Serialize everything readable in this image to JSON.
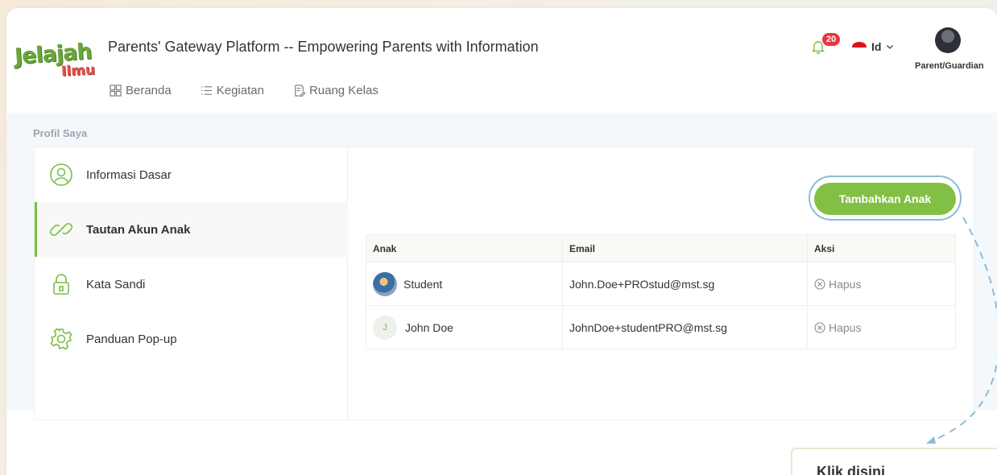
{
  "header": {
    "logo_line1": "Jelajah",
    "logo_line2": "Ilmu",
    "title": "Parents' Gateway Platform -- Empowering Parents with Information",
    "nav": [
      {
        "label": "Beranda",
        "icon": "grid-icon"
      },
      {
        "label": "Kegiatan",
        "icon": "list-icon"
      },
      {
        "label": "Ruang Kelas",
        "icon": "document-edit-icon"
      }
    ],
    "notification_count": "20",
    "language": "Id",
    "role": "Parent/Guardian"
  },
  "profile": {
    "section_title": "Profil Saya",
    "menu": [
      {
        "label": "Informasi Dasar",
        "icon": "user-circle-icon"
      },
      {
        "label": "Tautan Akun Anak",
        "icon": "link-icon",
        "active": true
      },
      {
        "label": "Kata Sandi",
        "icon": "lock-icon"
      },
      {
        "label": "Panduan Pop-up",
        "icon": "gear-icon"
      }
    ]
  },
  "children": {
    "add_button": "Tambahkan Anak",
    "columns": [
      "Anak",
      "Email",
      "Aksi"
    ],
    "rows": [
      {
        "name": "Student",
        "email": "John.Doe+PROstud@mst.sg",
        "action": "Hapus",
        "initial": ""
      },
      {
        "name": "John Doe",
        "email": "JohnDoe+studentPRO@mst.sg",
        "action": "Hapus",
        "initial": "J"
      }
    ]
  },
  "tooltip": {
    "title": "Klik disini"
  },
  "colors": {
    "accent_green": "#82c045",
    "highlight_ring": "#8cbcd8",
    "badge_red": "#e8353b"
  }
}
